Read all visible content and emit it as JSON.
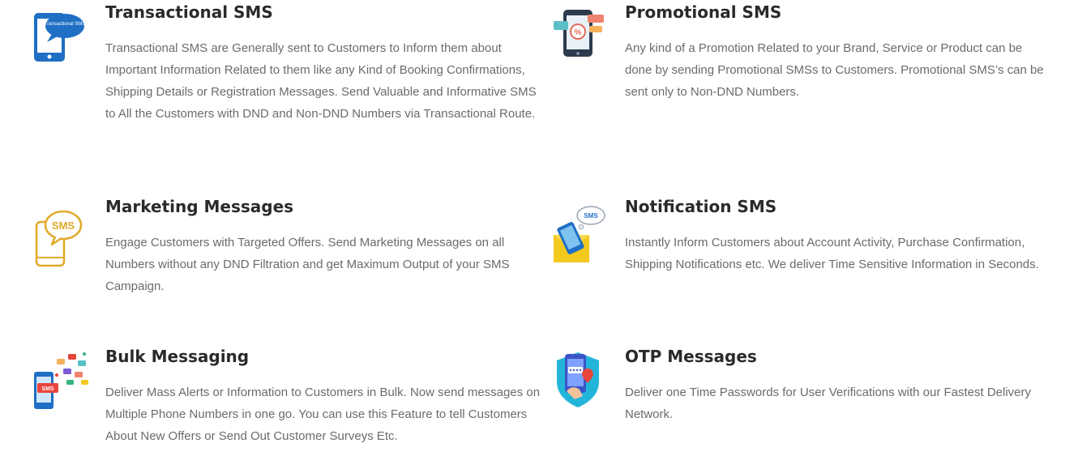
{
  "services": [
    {
      "id": "transactional",
      "icon": "transactional-sms-icon",
      "icon_text": "Transactional SMS",
      "title": "Transactional SMS",
      "description": "Transactional SMS are Generally sent to Customers to Inform them about Important Information Related to them like any Kind of Booking Confirmations, Shipping Details or Registration Messages. Send Valuable and Informative SMS to All the Customers with DND and Non-DND Numbers via Transactional Route."
    },
    {
      "id": "promotional",
      "icon": "promotional-sms-icon",
      "title": "Promotional SMS",
      "description": "Any kind of a Promotion Related to your Brand, Service or Product can be done by sending Promotional SMSs to Customers. Promotional SMS’s can be sent only to Non-DND Numbers."
    },
    {
      "id": "marketing",
      "icon": "marketing-messages-icon",
      "icon_text": "SMS",
      "title": "Marketing Messages",
      "description": "Engage Customers with Targeted Offers. Send Marketing Messages on all Numbers without any DND Filtration and get Maximum Output of your SMS Campaign."
    },
    {
      "id": "notification",
      "icon": "notification-sms-icon",
      "icon_text": "SMS",
      "title": "Notification SMS",
      "description": "Instantly Inform Customers about Account Activity, Purchase Confirmation, Shipping Notifications etc. We deliver Time Sensitive Information in Seconds."
    },
    {
      "id": "bulk",
      "icon": "bulk-messaging-icon",
      "icon_text": "SMS",
      "title": "Bulk Messaging",
      "description": "Deliver Mass Alerts or Information to Customers in Bulk. Now send messages on Multiple Phone Numbers in one go. You can use this Feature to tell Customers About New Offers or Send Out Customer Surveys Etc."
    },
    {
      "id": "otp",
      "icon": "otp-messages-icon",
      "title": "OTP Messages",
      "description": "Deliver one Time Passwords for User Verifications with our Fastest Delivery Network."
    }
  ],
  "colors": {
    "title": "#2a2a2a",
    "body": "#6b6b6b",
    "blue": "#1f6fc5",
    "gold": "#e0aa2a"
  }
}
